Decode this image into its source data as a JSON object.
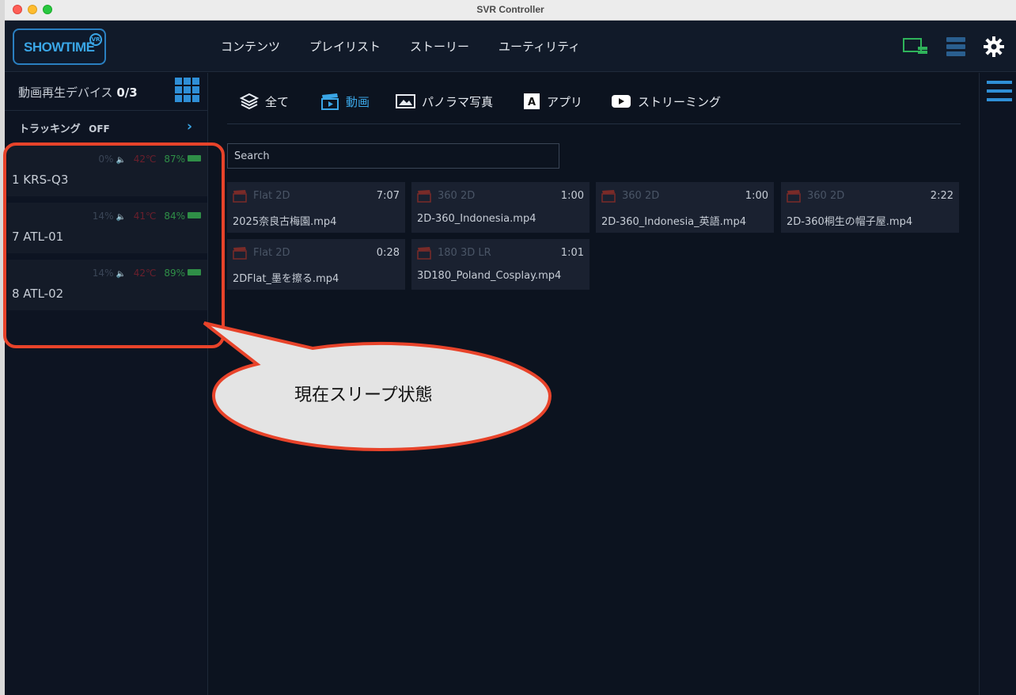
{
  "window": {
    "title": "SVR Controller"
  },
  "logo": {
    "text": "SHOWTIME",
    "badge": "VR"
  },
  "nav": {
    "items": [
      "コンテンツ",
      "プレイリスト",
      "ストーリー",
      "ユーティリティ"
    ]
  },
  "sidebar": {
    "devices_label": "動画再生デバイス",
    "devices_count": "0/3",
    "tracking_label": "トラッキング",
    "tracking_state": "OFF",
    "devices": [
      {
        "name": "1  KRS-Q3",
        "volume": "0%",
        "temp": "42℃",
        "battery": "87%"
      },
      {
        "name": "7  ATL-01",
        "volume": "14%",
        "temp": "41℃",
        "battery": "84%"
      },
      {
        "name": "8  ATL-02",
        "volume": "14%",
        "temp": "42℃",
        "battery": "89%"
      }
    ]
  },
  "filters": {
    "tabs": [
      {
        "label": "全て",
        "icon": "layers-icon"
      },
      {
        "label": "動画",
        "icon": "clapperboard-icon",
        "active": true
      },
      {
        "label": "パノラマ写真",
        "icon": "panorama-icon"
      },
      {
        "label": "アプリ",
        "icon": "app-letter-icon"
      },
      {
        "label": "ストリーミング",
        "icon": "youtube-icon"
      }
    ]
  },
  "search": {
    "placeholder": "Search"
  },
  "videos": [
    {
      "type": "Flat 2D",
      "duration": "7:07",
      "file": "2025奈良古梅園.mp4"
    },
    {
      "type": "360 2D",
      "duration": "1:00",
      "file": "2D-360_Indonesia.mp4"
    },
    {
      "type": "360 2D",
      "duration": "1:00",
      "file": "2D-360_Indonesia_英語.mp4"
    },
    {
      "type": "360 2D",
      "duration": "2:22",
      "file": "2D-360桐生の帽子屋.mp4"
    },
    {
      "type": "Flat 2D",
      "duration": "0:28",
      "file": "2DFlat_墨を擦る.mp4"
    },
    {
      "type": "180 3D LR",
      "duration": "1:01",
      "file": "3D180_Poland_Cosplay.mp4"
    }
  ],
  "annotation": {
    "callout": "現在スリープ状態"
  },
  "colors": {
    "accent": "#3aa6e6",
    "background": "#0c131f",
    "callout_border": "#e8432a",
    "battery": "#2f8f47",
    "temperature": "#6b1f2c"
  }
}
